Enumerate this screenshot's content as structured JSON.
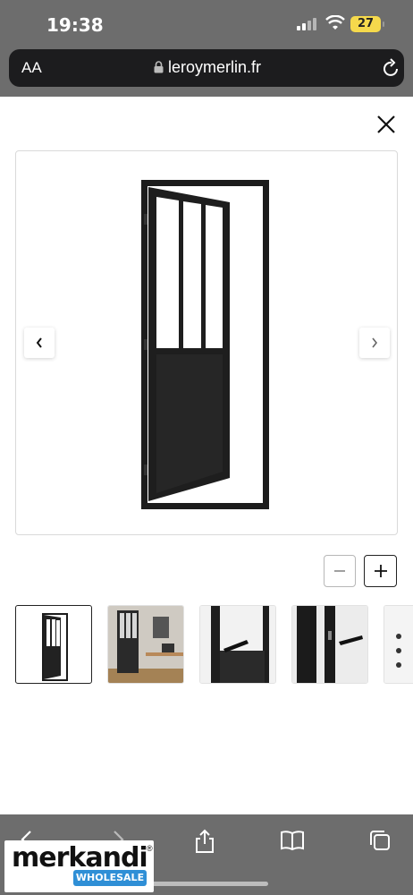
{
  "status_bar": {
    "time": "19:38",
    "battery": "27"
  },
  "browser": {
    "text_size_label": "AA",
    "url": "leroymerlin.fr"
  },
  "viewer": {
    "image_alt": "porte atelier vitrée noire",
    "thumbnails": [
      {
        "name": "thumb-door-front",
        "active": true
      },
      {
        "name": "thumb-door-room"
      },
      {
        "name": "thumb-handle-closeup"
      },
      {
        "name": "thumb-lock-closeup"
      },
      {
        "name": "thumb-partial"
      }
    ]
  },
  "zoom": {
    "out_symbol": "−",
    "in_symbol": "+"
  },
  "watermark": {
    "brand": "merkandi",
    "sub": "WHOLESALE",
    "reg": "®"
  },
  "colors": {
    "frame": "#1b1b1b",
    "chrome": "#6d6d6d",
    "accent": "#2f8fd6"
  }
}
